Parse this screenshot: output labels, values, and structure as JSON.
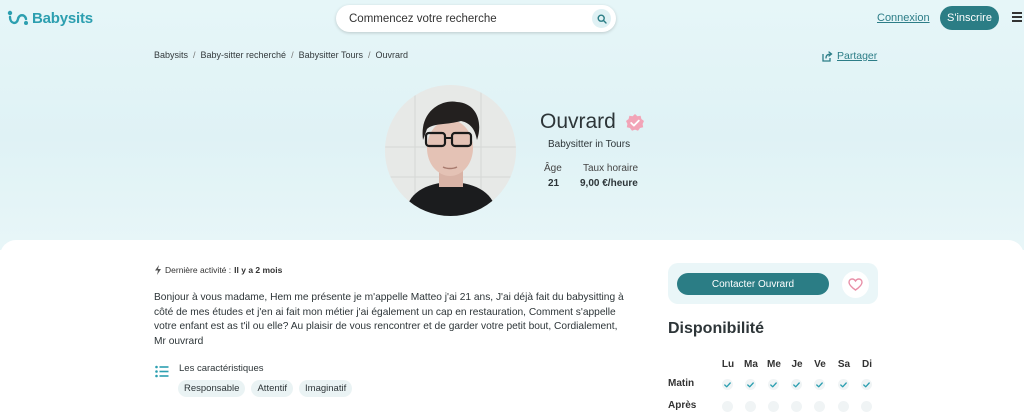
{
  "header": {
    "logo_text": "Babysits",
    "search_placeholder": "Commencez votre recherche",
    "login_label": "Connexion",
    "signup_label": "S'inscrire"
  },
  "breadcrumb": {
    "items": [
      "Babysits",
      "Baby-sitter recherché",
      "Babysitter Tours",
      "Ouvrard"
    ]
  },
  "share_label": "Partager",
  "profile": {
    "name": "Ouvrard",
    "subtitle": "Babysitter in Tours",
    "age_label": "Âge",
    "age_value": "21",
    "rate_label": "Taux horaire",
    "rate_value": "9,00 €/heure"
  },
  "activity": {
    "label": "Dernière activité :",
    "value": "Il y a 2 mois"
  },
  "bio": "Bonjour à vous madame, Hem me présente je m'appelle Matteo j'ai 21 ans, J'ai déjà fait du babysitting à côté de mes études et j'en ai fait mon métier j'ai également un cap en restauration, Comment s'appelle votre enfant est as t'il ou elle? Au plaisir de vous rencontrer et de garder votre petit bout, Cordialement, Mr ouvrard",
  "characteristics": {
    "title": "Les caractéristiques",
    "tags": [
      "Responsable",
      "Attentif",
      "Imaginatif"
    ]
  },
  "contact_label": "Contacter Ouvrard",
  "availability": {
    "title": "Disponibilité",
    "days": [
      "Lu",
      "Ma",
      "Me",
      "Je",
      "Ve",
      "Sa",
      "Di"
    ],
    "rows": [
      {
        "label": "Matin",
        "available": [
          true,
          true,
          true,
          true,
          true,
          true,
          true
        ]
      },
      {
        "label": "Après",
        "available": [
          false,
          false,
          false,
          false,
          false,
          false,
          false
        ]
      }
    ]
  },
  "colors": {
    "brand": "#2c9fb0",
    "button": "#2b7d85",
    "verified": "#f0a0b4",
    "hero_bg": "#e3f4f7"
  }
}
